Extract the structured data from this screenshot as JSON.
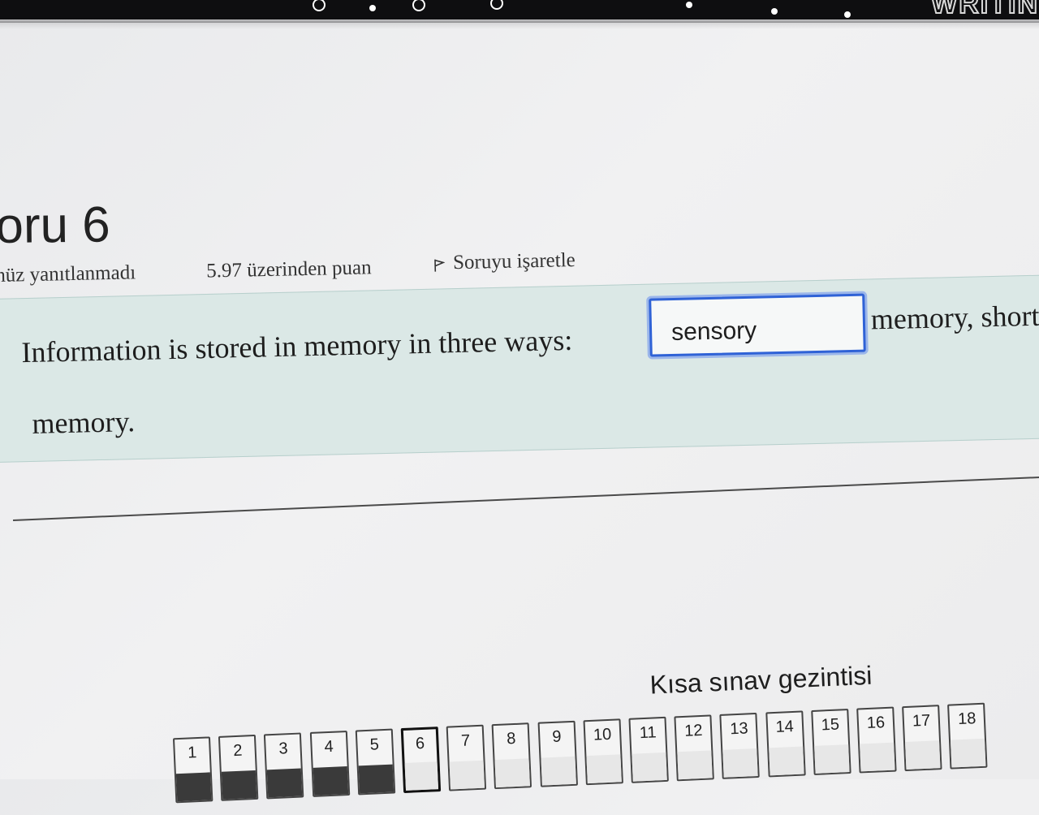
{
  "window": {
    "top_banner_text": "WRITIN"
  },
  "question": {
    "title": "oru 6",
    "status": "nüz yanıtlanmadı",
    "points": "5.97 üzerinden puan",
    "flag_label": "Soruyu işaretle",
    "text_before": "Information is stored in memory in three ways:",
    "answer_value": "sensory",
    "text_after": "memory, short",
    "text_end": "memory."
  },
  "navigation": {
    "title": "Kısa sınav gezintisi",
    "current": "6",
    "buttons": [
      "1",
      "2",
      "3",
      "4",
      "5",
      "6",
      "7",
      "8",
      "9",
      "10",
      "11",
      "12",
      "13",
      "14",
      "15",
      "16",
      "17",
      "18"
    ]
  },
  "colors": {
    "accent_blue": "#2f62d6",
    "question_bg": "#dbe8e6"
  }
}
